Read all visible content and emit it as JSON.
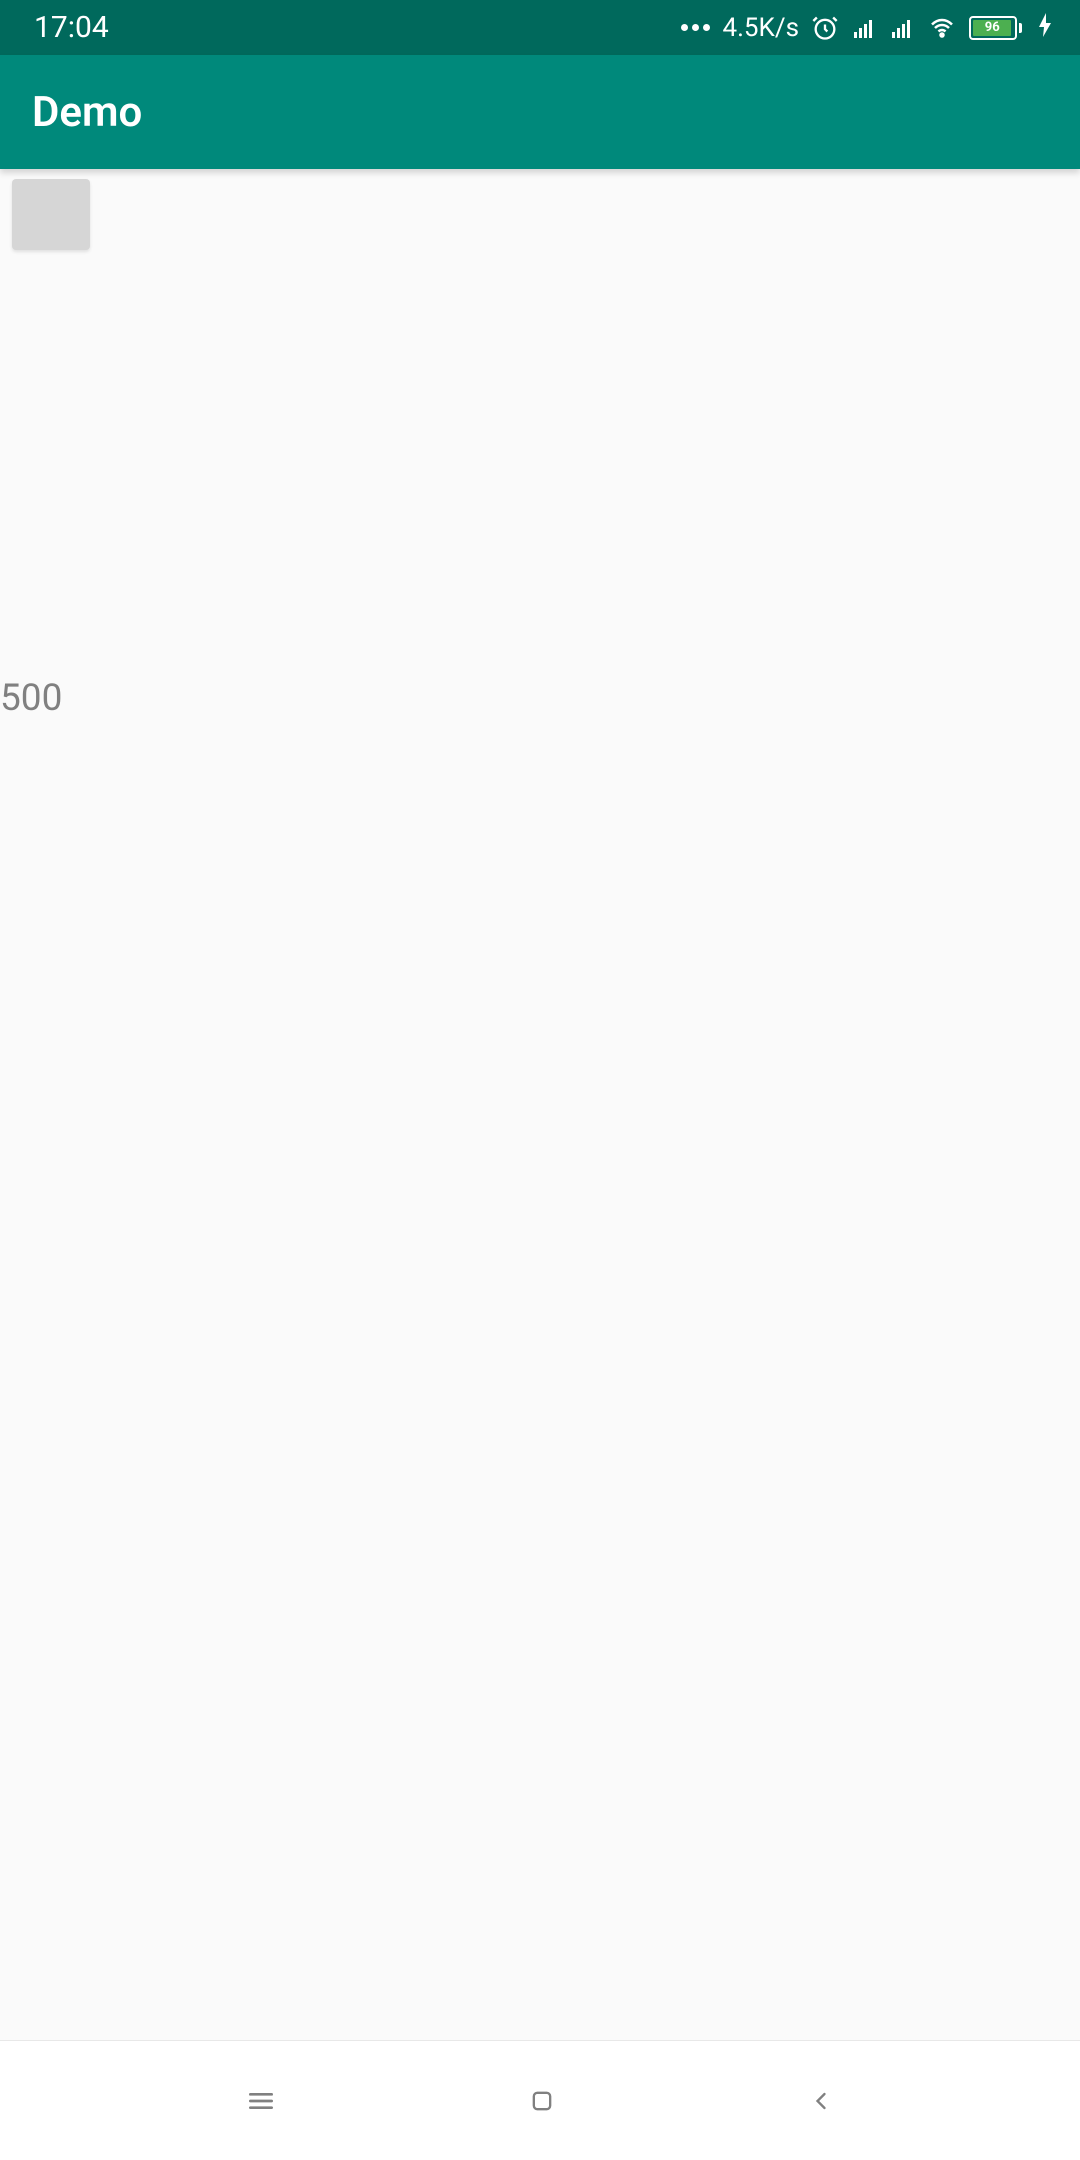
{
  "status_bar": {
    "time": "17:04",
    "network_speed": "4.5K/s",
    "battery_percent": "96"
  },
  "app_bar": {
    "title": "Demo"
  },
  "content": {
    "value": "500"
  }
}
